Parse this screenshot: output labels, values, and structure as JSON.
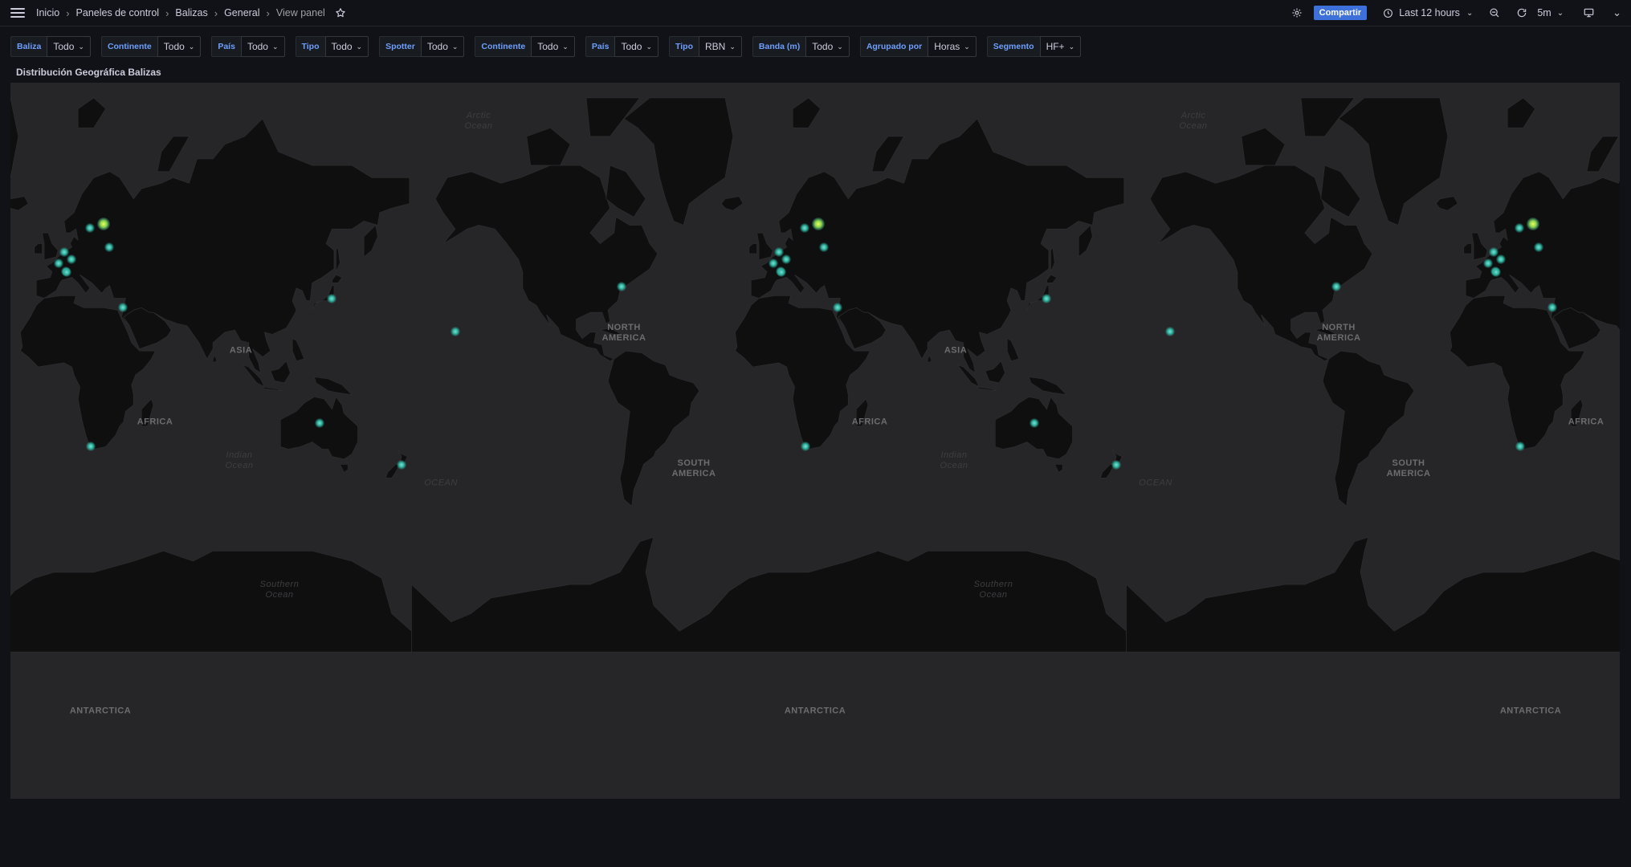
{
  "breadcrumb": {
    "items": [
      "Inicio",
      "Paneles de control",
      "Balizas",
      "General"
    ],
    "current": "View panel"
  },
  "toolbar": {
    "share_label": "Compartir",
    "time_range": "Last 12 hours",
    "refresh_interval": "5m",
    "accent_color": "#3d71d9"
  },
  "icons": [
    "menu-icon",
    "star-icon",
    "gear-icon",
    "clock-icon",
    "zoom-out-icon",
    "refresh-icon",
    "monitor-icon",
    "chevron-down-icon"
  ],
  "variables": [
    {
      "label": "Baliza",
      "value": "Todo"
    },
    {
      "label": "Continente",
      "value": "Todo"
    },
    {
      "label": "País",
      "value": "Todo"
    },
    {
      "label": "Tipo",
      "value": "Todo"
    },
    {
      "label": "Spotter",
      "value": "Todo"
    },
    {
      "label": "Continente",
      "value": "Todo"
    },
    {
      "label": "País",
      "value": "Todo"
    },
    {
      "label": "Tipo",
      "value": "RBN"
    },
    {
      "label": "Banda (m)",
      "value": "Todo"
    },
    {
      "label": "Agrupado por",
      "value": "Horas"
    },
    {
      "label": "Segmento",
      "value": "HF+"
    }
  ],
  "panel": {
    "title": "Distribución Geográfica Balizas"
  },
  "map": {
    "labels": {
      "asia": "ASIA",
      "africa": "AFRICA",
      "north_america": "NORTH\nAMERICA",
      "south_america": "SOUTH\nAMERICA",
      "antarctica": "ANTARCTICA",
      "arctic_ocean": "Arctic\nOcean",
      "indian_ocean": "Indian\nOcean",
      "southern_ocean": "Southern\nOcean",
      "ocean": "OCEAN"
    },
    "beacons": [
      {
        "lat": 60.2,
        "lon": 24.9,
        "hot": true
      },
      {
        "lat": 59.3,
        "lon": 18.1,
        "hot": false
      },
      {
        "lat": 52.4,
        "lon": 4.9,
        "hot": false
      },
      {
        "lat": 50.1,
        "lon": 8.7,
        "hot": false
      },
      {
        "lat": 48.9,
        "lon": 2.3,
        "hot": false
      },
      {
        "lat": 46.2,
        "lon": 6.1,
        "hot": false
      },
      {
        "lat": 46.0,
        "lon": 6.4,
        "hot": false
      },
      {
        "lat": 53.9,
        "lon": 27.6,
        "hot": false
      },
      {
        "lat": 32.1,
        "lon": 34.8,
        "hot": false
      },
      {
        "lat": 35.7,
        "lon": 139.7,
        "hot": false
      },
      {
        "lat": 40.7,
        "lon": -74.0,
        "hot": false
      },
      {
        "lat": 21.3,
        "lon": -157.8,
        "hot": false
      },
      {
        "lat": -23.7,
        "lon": 133.9,
        "hot": false
      },
      {
        "lat": -41.3,
        "lon": 174.8,
        "hot": false
      },
      {
        "lat": -33.9,
        "lon": 18.4,
        "hot": false
      }
    ]
  }
}
